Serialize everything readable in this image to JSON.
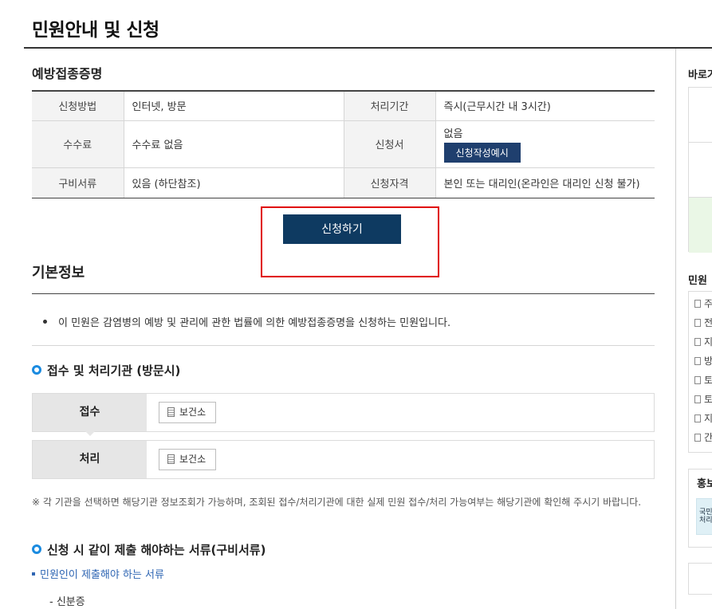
{
  "page": {
    "title": "민원안내 및 신청"
  },
  "summary": {
    "section_title": "예방접종증명",
    "rows": [
      {
        "label1": "신청방법",
        "value1": "인터넷, 방문",
        "label2": "처리기간",
        "value2": "즉시(근무시간 내 3시간)"
      },
      {
        "label1": "수수료",
        "value1": "수수료 없음",
        "label2": "신청서",
        "value2": "없음",
        "value2_button": "신청작성예시"
      },
      {
        "label1": "구비서류",
        "value1": "있음 (하단참조)",
        "label2": "신청자격",
        "value2": "본인 또는 대리인(온라인은 대리인 신청 불가)"
      }
    ],
    "apply_button": "신청하기"
  },
  "basic_info": {
    "title": "기본정보",
    "description": "이 민원은 감염병의 예방 및 관리에 관한 법률에 의한 예방접종증명을 신청하는 민원입니다."
  },
  "agencies": {
    "title": "접수 및 처리기관 (방문시)",
    "rows": [
      {
        "label": "접수",
        "button": "보건소"
      },
      {
        "label": "처리",
        "button": "보건소"
      }
    ],
    "note": "※ 각 기관을 선택하면 해당기관 정보조회가 가능하며, 조회된 접수/처리기관에 대한 실제 민원 접수/처리 가능여부는 해당기관에 확인해 주시기 바랍니다."
  },
  "documents": {
    "title": "신청 시 같이 제출 해야하는 서류(구비서류)",
    "link": "민원인이 제출해야 하는 서류",
    "items": [
      "- 신분증"
    ]
  },
  "sidebar": {
    "title1": "바로가",
    "title2": "민원",
    "list_items": [
      "주",
      "전",
      "지",
      "방",
      "토",
      "토",
      "지",
      "간"
    ],
    "promo_title": "홍보",
    "promo_thumb": "국민 처리"
  },
  "colors": {
    "primary_button": "#0e3a61",
    "secondary_button": "#1f3f6e",
    "highlight": "#e00000",
    "accent_ring": "#1b8be0",
    "link": "#2f66b3"
  }
}
